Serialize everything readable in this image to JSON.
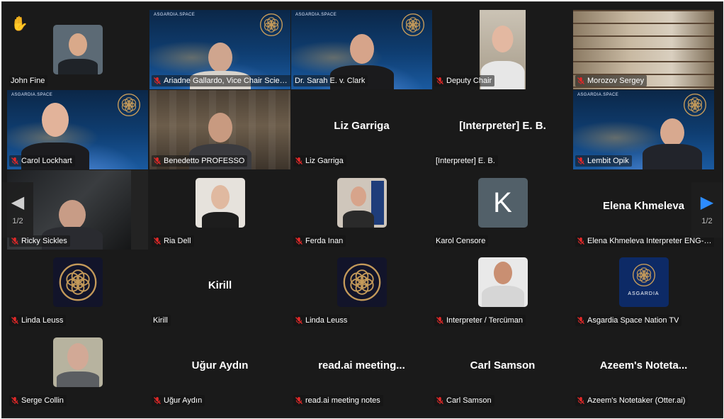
{
  "raise_hand_icon": "raised-hand-icon",
  "muted_icon": "muted-microphone-icon",
  "active_speaker_color": "#2ccc71",
  "brand_text": "ASGARDIA.SPACE",
  "pagination": {
    "left_page": "1/2",
    "right_page": "1/2",
    "left_icon": "chevron-left-icon",
    "right_icon": "chevron-right-icon"
  },
  "participants": {
    "john_fine": {
      "label": "John Fine"
    },
    "ariadne": {
      "label": "Ariadne Gallardo, Vice Chair Scien..."
    },
    "sarah": {
      "label": "Dr. Sarah E. v. Clark"
    },
    "deputy": {
      "label": "Deputy Chair"
    },
    "morozov": {
      "label": "Morozov Sergey"
    },
    "carol": {
      "label": "Carol Lockhart"
    },
    "benedetto": {
      "label": "Benedetto PROFESSO"
    },
    "liz": {
      "display": "Liz Garriga",
      "label": "Liz Garriga"
    },
    "interpreter_eb": {
      "display": "[Interpreter] E. B.",
      "label": "[Interpreter] E. B."
    },
    "lembit": {
      "label": "Lembit Opik"
    },
    "ricky": {
      "label": "Ricky Sickles"
    },
    "ria": {
      "label": "Ria Dell"
    },
    "ferda": {
      "label": "Ferda Inan"
    },
    "karol": {
      "label": "Karol Censore",
      "avatar_letter": "K"
    },
    "elena": {
      "display": "Elena Khmeleva",
      "label": "Elena Khmeleva Interpreter ENG-R..."
    },
    "linda1": {
      "label": "Linda Leuss"
    },
    "kirill": {
      "display": "Kirill",
      "label": "Kirill"
    },
    "linda2": {
      "label": "Linda Leuss"
    },
    "tercuman": {
      "label": "Interpreter / Tercüman"
    },
    "asgardia_tv": {
      "label": "Asgardia Space Nation TV",
      "logo_text": "ASGARDIA"
    },
    "serge": {
      "label": "Serge Collin"
    },
    "ugur": {
      "display": "Uğur Aydın",
      "label": "Uğur Aydın"
    },
    "readai": {
      "display": "read.ai  meeting...",
      "label": "read.ai meeting notes"
    },
    "carl": {
      "display": "Carl Samson",
      "label": "Carl Samson"
    },
    "azeem": {
      "display": "Azeem's  Noteta...",
      "label": "Azeem's Notetaker (Otter.ai)"
    }
  }
}
